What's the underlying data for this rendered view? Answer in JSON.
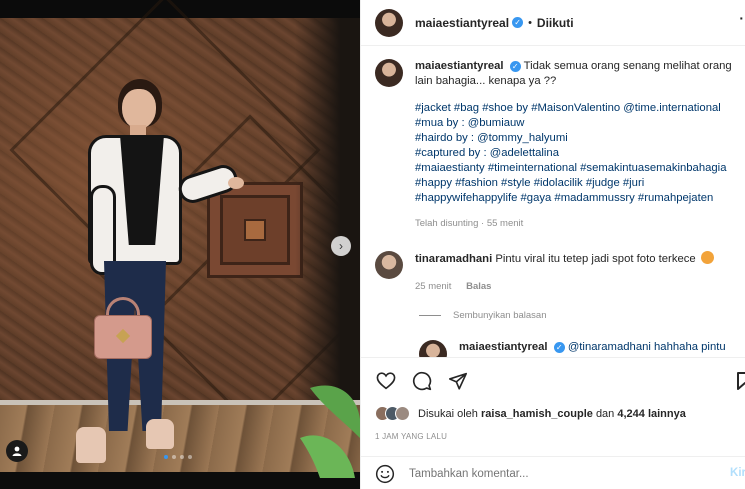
{
  "post_header": {
    "username": "maiaestiantyreal",
    "separator": "•",
    "follow_status": "Diikuti",
    "more_symbol": "·"
  },
  "caption": {
    "username": "maiaestiantyreal",
    "text_line1": "Tidak semua orang senang melihat orang",
    "text_line2": "lain bahagia... kenapa ya ??",
    "tag_lines": [
      "#jacket #bag #shoe by #MaisonValentino @time.international",
      "#mua by : @bumiauw",
      "#hairdo by : @tommy_halyumi",
      "#captured by : @adelettalina",
      "#maiaestianty #timeinternational #semakintuasemakinbahagia",
      "#happy #fashion #style #idolacilik #judge #juri",
      "#happywifehappylife #gaya #madammussry #rumahpejaten"
    ],
    "meta": "Telah disunting · 55 menit"
  },
  "comment1": {
    "username": "tinaramadhani",
    "text": "Pintu viral itu tetep jadi spot foto terkece",
    "time": "25 menit",
    "reply_label": "Balas"
  },
  "hide_replies_label": "Sembunyikan balasan",
  "comment2": {
    "username": "maiaestiantyreal",
    "text": "@tinaramadhani hahhaha pintu"
  },
  "likes": {
    "prefix": "Disukai oleh",
    "liker": "raisa_hamish_couple",
    "middle": "dan",
    "count": "4,244 lainnya"
  },
  "timestamp": "1 JAM YANG LALU",
  "comment_box": {
    "placeholder": "Tambahkan komentar...",
    "post_label": "Kir"
  },
  "media": {
    "next_symbol": "›",
    "carousel_dots": 4,
    "active_dot": 0
  },
  "colors": {
    "link": "#00376b",
    "verified": "#3897f0",
    "muted": "#8e8e8e"
  }
}
